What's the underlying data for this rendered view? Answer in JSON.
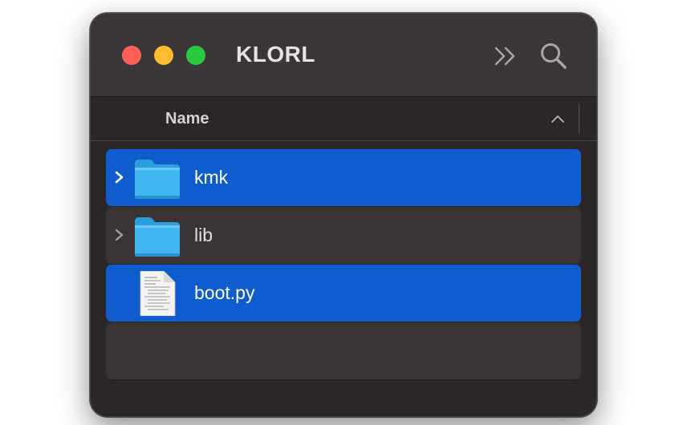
{
  "window": {
    "title": "KLORL"
  },
  "colors": {
    "close": "#fe5f57",
    "minimize": "#febc2e",
    "maximize": "#28c840",
    "selection": "#0e5ccd",
    "folder": "#3fb6f2"
  },
  "toolbar": {
    "more_icon": "double-chevron-right-icon",
    "search_icon": "magnifier-icon"
  },
  "list_header": {
    "name_column": "Name",
    "sort_icon": "chevron-up-icon"
  },
  "items": [
    {
      "name": "kmk",
      "kind": "folder",
      "selected": true,
      "expandable": true
    },
    {
      "name": "lib",
      "kind": "folder",
      "selected": false,
      "expandable": true
    },
    {
      "name": "boot.py",
      "kind": "document",
      "selected": true,
      "expandable": false
    }
  ]
}
